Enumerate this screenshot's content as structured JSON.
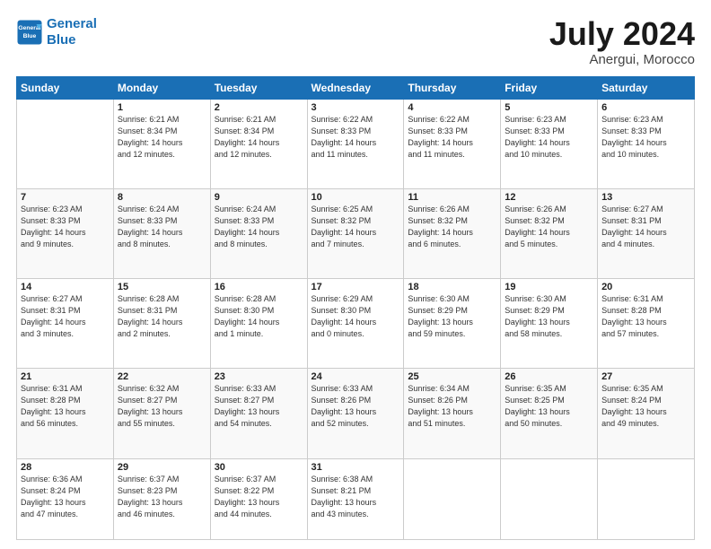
{
  "logo": {
    "line1": "General",
    "line2": "Blue"
  },
  "title": "July 2024",
  "subtitle": "Anergui, Morocco",
  "days_of_week": [
    "Sunday",
    "Monday",
    "Tuesday",
    "Wednesday",
    "Thursday",
    "Friday",
    "Saturday"
  ],
  "weeks": [
    [
      {
        "day": "",
        "info": ""
      },
      {
        "day": "1",
        "info": "Sunrise: 6:21 AM\nSunset: 8:34 PM\nDaylight: 14 hours\nand 12 minutes."
      },
      {
        "day": "2",
        "info": "Sunrise: 6:21 AM\nSunset: 8:34 PM\nDaylight: 14 hours\nand 12 minutes."
      },
      {
        "day": "3",
        "info": "Sunrise: 6:22 AM\nSunset: 8:33 PM\nDaylight: 14 hours\nand 11 minutes."
      },
      {
        "day": "4",
        "info": "Sunrise: 6:22 AM\nSunset: 8:33 PM\nDaylight: 14 hours\nand 11 minutes."
      },
      {
        "day": "5",
        "info": "Sunrise: 6:23 AM\nSunset: 8:33 PM\nDaylight: 14 hours\nand 10 minutes."
      },
      {
        "day": "6",
        "info": "Sunrise: 6:23 AM\nSunset: 8:33 PM\nDaylight: 14 hours\nand 10 minutes."
      }
    ],
    [
      {
        "day": "7",
        "info": "Sunrise: 6:23 AM\nSunset: 8:33 PM\nDaylight: 14 hours\nand 9 minutes."
      },
      {
        "day": "8",
        "info": "Sunrise: 6:24 AM\nSunset: 8:33 PM\nDaylight: 14 hours\nand 8 minutes."
      },
      {
        "day": "9",
        "info": "Sunrise: 6:24 AM\nSunset: 8:33 PM\nDaylight: 14 hours\nand 8 minutes."
      },
      {
        "day": "10",
        "info": "Sunrise: 6:25 AM\nSunset: 8:32 PM\nDaylight: 14 hours\nand 7 minutes."
      },
      {
        "day": "11",
        "info": "Sunrise: 6:26 AM\nSunset: 8:32 PM\nDaylight: 14 hours\nand 6 minutes."
      },
      {
        "day": "12",
        "info": "Sunrise: 6:26 AM\nSunset: 8:32 PM\nDaylight: 14 hours\nand 5 minutes."
      },
      {
        "day": "13",
        "info": "Sunrise: 6:27 AM\nSunset: 8:31 PM\nDaylight: 14 hours\nand 4 minutes."
      }
    ],
    [
      {
        "day": "14",
        "info": "Sunrise: 6:27 AM\nSunset: 8:31 PM\nDaylight: 14 hours\nand 3 minutes."
      },
      {
        "day": "15",
        "info": "Sunrise: 6:28 AM\nSunset: 8:31 PM\nDaylight: 14 hours\nand 2 minutes."
      },
      {
        "day": "16",
        "info": "Sunrise: 6:28 AM\nSunset: 8:30 PM\nDaylight: 14 hours\nand 1 minute."
      },
      {
        "day": "17",
        "info": "Sunrise: 6:29 AM\nSunset: 8:30 PM\nDaylight: 14 hours\nand 0 minutes."
      },
      {
        "day": "18",
        "info": "Sunrise: 6:30 AM\nSunset: 8:29 PM\nDaylight: 13 hours\nand 59 minutes."
      },
      {
        "day": "19",
        "info": "Sunrise: 6:30 AM\nSunset: 8:29 PM\nDaylight: 13 hours\nand 58 minutes."
      },
      {
        "day": "20",
        "info": "Sunrise: 6:31 AM\nSunset: 8:28 PM\nDaylight: 13 hours\nand 57 minutes."
      }
    ],
    [
      {
        "day": "21",
        "info": "Sunrise: 6:31 AM\nSunset: 8:28 PM\nDaylight: 13 hours\nand 56 minutes."
      },
      {
        "day": "22",
        "info": "Sunrise: 6:32 AM\nSunset: 8:27 PM\nDaylight: 13 hours\nand 55 minutes."
      },
      {
        "day": "23",
        "info": "Sunrise: 6:33 AM\nSunset: 8:27 PM\nDaylight: 13 hours\nand 54 minutes."
      },
      {
        "day": "24",
        "info": "Sunrise: 6:33 AM\nSunset: 8:26 PM\nDaylight: 13 hours\nand 52 minutes."
      },
      {
        "day": "25",
        "info": "Sunrise: 6:34 AM\nSunset: 8:26 PM\nDaylight: 13 hours\nand 51 minutes."
      },
      {
        "day": "26",
        "info": "Sunrise: 6:35 AM\nSunset: 8:25 PM\nDaylight: 13 hours\nand 50 minutes."
      },
      {
        "day": "27",
        "info": "Sunrise: 6:35 AM\nSunset: 8:24 PM\nDaylight: 13 hours\nand 49 minutes."
      }
    ],
    [
      {
        "day": "28",
        "info": "Sunrise: 6:36 AM\nSunset: 8:24 PM\nDaylight: 13 hours\nand 47 minutes."
      },
      {
        "day": "29",
        "info": "Sunrise: 6:37 AM\nSunset: 8:23 PM\nDaylight: 13 hours\nand 46 minutes."
      },
      {
        "day": "30",
        "info": "Sunrise: 6:37 AM\nSunset: 8:22 PM\nDaylight: 13 hours\nand 44 minutes."
      },
      {
        "day": "31",
        "info": "Sunrise: 6:38 AM\nSunset: 8:21 PM\nDaylight: 13 hours\nand 43 minutes."
      },
      {
        "day": "",
        "info": ""
      },
      {
        "day": "",
        "info": ""
      },
      {
        "day": "",
        "info": ""
      }
    ]
  ]
}
